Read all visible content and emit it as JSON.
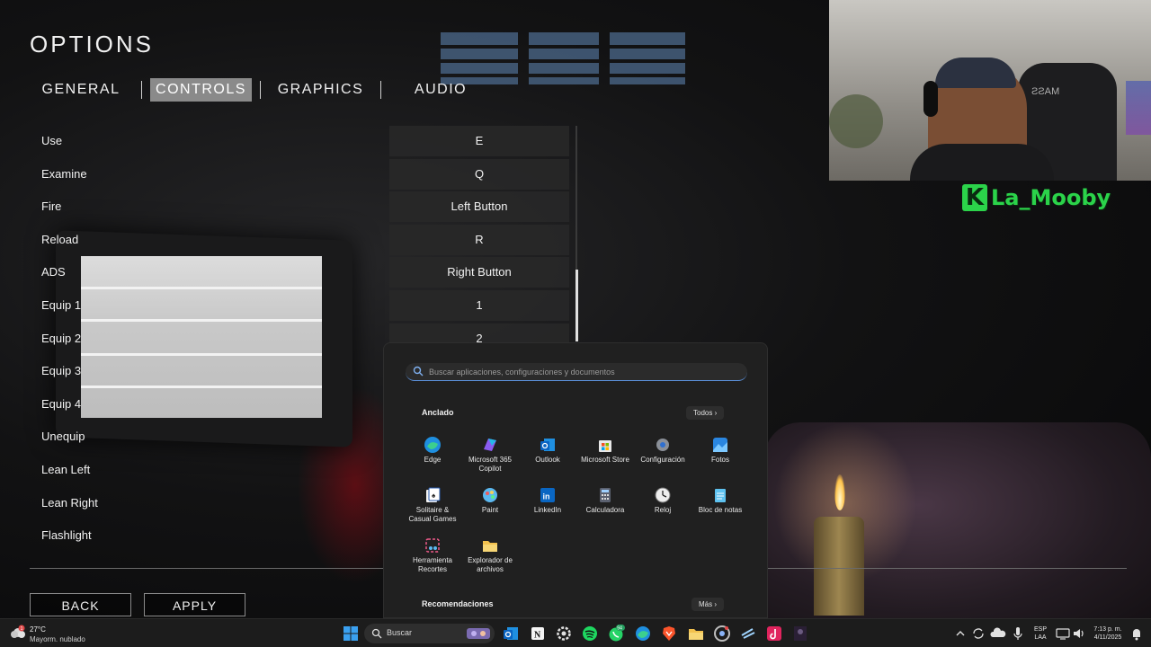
{
  "options": {
    "title": "OPTIONS",
    "tabs": [
      {
        "label": "GENERAL",
        "active": false
      },
      {
        "label": "CONTROLS",
        "active": true
      },
      {
        "label": "GRAPHICS",
        "active": false
      },
      {
        "label": "AUDIO",
        "active": false
      }
    ],
    "bindings": [
      {
        "action": "Use",
        "key": "E"
      },
      {
        "action": "Examine",
        "key": "Q"
      },
      {
        "action": "Fire",
        "key": "Left Button"
      },
      {
        "action": "Reload",
        "key": "R"
      },
      {
        "action": "ADS",
        "key": "Right Button"
      },
      {
        "action": "Equip 1",
        "key": "1"
      },
      {
        "action": "Equip 2",
        "key": "2"
      },
      {
        "action": "Equip 3",
        "key": ""
      },
      {
        "action": "Equip 4",
        "key": ""
      },
      {
        "action": "Unequip",
        "key": ""
      },
      {
        "action": "Lean Left",
        "key": ""
      },
      {
        "action": "Lean Right",
        "key": ""
      },
      {
        "action": "Flashlight",
        "key": ""
      }
    ],
    "back_label": "BACK",
    "apply_label": "APPLY"
  },
  "webcam": {
    "chair_text": "MASS",
    "streamer_logo": "K",
    "streamer_name": "La_Mooby",
    "streamer_color": "#2bd34a"
  },
  "start_menu": {
    "search_placeholder": "Buscar aplicaciones, configuraciones y documentos",
    "pinned_title": "Anclado",
    "all_label": "Todos",
    "recommended_title": "Recomendaciones",
    "more_label": "Más",
    "apps": [
      {
        "label": "Edge",
        "icon": "edge-icon"
      },
      {
        "label": "Microsoft 365\nCopilot",
        "icon": "copilot-icon"
      },
      {
        "label": "Outlook",
        "icon": "outlook-icon"
      },
      {
        "label": "Microsoft Store",
        "icon": "store-icon"
      },
      {
        "label": "Configuración",
        "icon": "settings-icon"
      },
      {
        "label": "Fotos",
        "icon": "photos-icon"
      },
      {
        "label": "Solitaire &\nCasual Games",
        "icon": "solitaire-icon"
      },
      {
        "label": "Paint",
        "icon": "paint-icon"
      },
      {
        "label": "LinkedIn",
        "icon": "linkedin-icon"
      },
      {
        "label": "Calculadora",
        "icon": "calculator-icon"
      },
      {
        "label": "Reloj",
        "icon": "clock-icon"
      },
      {
        "label": "Bloc de notas",
        "icon": "notepad-icon"
      },
      {
        "label": "Herramienta\nRecortes",
        "icon": "snipping-icon"
      },
      {
        "label": "Explorador de\narchivos",
        "icon": "file-explorer-icon"
      }
    ]
  },
  "taskbar": {
    "weather_temp": "27°C",
    "weather_condition": "Mayorm. nublado",
    "weather_badge": "1",
    "search_label": "Buscar",
    "whatsapp_badge": "94",
    "lang_line1": "ESP",
    "lang_line2": "LAA",
    "time": "7:13 p. m.",
    "date": "4/11/2025"
  }
}
